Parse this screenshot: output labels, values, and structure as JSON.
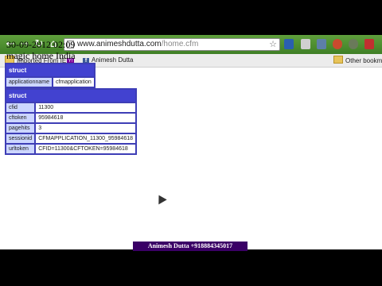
{
  "browser": {
    "url_host": "www.animeshdutta.com",
    "url_path": "/home.cfm",
    "nav_icons": [
      "back-icon",
      "forward-icon",
      "reload-icon",
      "home-icon"
    ],
    "bookmarks": [
      {
        "label": "Imported From IE",
        "icon": "folder-icon"
      },
      {
        "label": "Y!",
        "icon": "yahoo-icon"
      },
      {
        "label": "Animesh Dutta",
        "icon": "facebook-icon"
      },
      {
        "label": "Other bookm",
        "icon": "folder-icon"
      }
    ],
    "accent_color": "#4a8c2d"
  },
  "page": {
    "datetime": "30-09-2012 02:09",
    "heading": "magic home India"
  },
  "dump_application": {
    "title": "struct",
    "rows": [
      {
        "key": "applicationname",
        "value": "cfmapplication"
      }
    ]
  },
  "dump_session": {
    "title": "struct",
    "rows": [
      {
        "key": "cfid",
        "value": "11300"
      },
      {
        "key": "cftoken",
        "value": "95984618"
      },
      {
        "key": "pagehits",
        "value": "3"
      },
      {
        "key": "sessionid",
        "value": "CFMAPPLICATION_11300_95984618"
      },
      {
        "key": "urltoken",
        "value": "CFID=11300&CFTOKEN=95984618"
      }
    ]
  },
  "watermark": "Animesh Dutta +918884345017"
}
